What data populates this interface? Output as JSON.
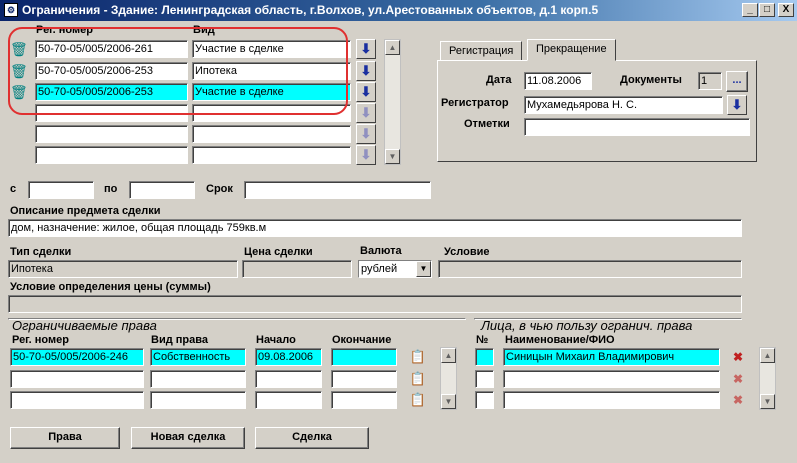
{
  "window": {
    "title": "Ограничения - Здание: Ленинградская область, г.Волхов, ул.Арестованных объектов, д.1 корп.5",
    "minimize": "_",
    "maximize": "□",
    "close": "X"
  },
  "deals": {
    "col_reg": "Рег. номер",
    "col_kind": "Вид",
    "rows": [
      {
        "reg": "50-70-05/005/2006-261",
        "kind": "Участие в сделке"
      },
      {
        "reg": "50-70-05/005/2006-253",
        "kind": "Ипотека"
      },
      {
        "reg": "50-70-05/005/2006-253",
        "kind": "Участие в сделке"
      },
      {
        "reg": "",
        "kind": ""
      },
      {
        "reg": "",
        "kind": ""
      },
      {
        "reg": "",
        "kind": ""
      }
    ]
  },
  "tabs": {
    "registration": "Регистрация",
    "termination": "Прекращение"
  },
  "termination": {
    "date_label": "Дата",
    "date_value": "11.08.2006",
    "docs_label": "Документы",
    "docs_value": "1",
    "docs_button": "...",
    "registrar_label": "Регистратор",
    "registrar_value": "Мухамедьярова Н. С.",
    "notes_label": "Отметки",
    "notes_value": ""
  },
  "period": {
    "from_label": "с",
    "from_value": "",
    "to_label": "по",
    "to_value": "",
    "term_label": "Срок",
    "term_value": ""
  },
  "subject": {
    "label": "Описание предмета сделки",
    "value": "дом, назначение: жилое, общая площадь 759кв.м"
  },
  "deal_info": {
    "type_label": "Тип сделки",
    "type_value": "Ипотека",
    "price_label": "Цена сделки",
    "price_value": "",
    "currency_label": "Валюта",
    "currency_value": "рублей",
    "condition_label": "Условие",
    "condition_value": "",
    "price_cond_label": "Условие определения цены (суммы)",
    "price_cond_value": ""
  },
  "rights": {
    "heading": "Ограничиваемые права",
    "col_reg": "Рег. номер",
    "col_kind": "Вид права",
    "col_start": "Начало",
    "col_end": "Окончание",
    "rows": [
      {
        "reg": "50-70-05/005/2006-246",
        "kind": "Собственность",
        "start": "09.08.2006",
        "end": ""
      },
      {
        "reg": "",
        "kind": "",
        "start": "",
        "end": ""
      },
      {
        "reg": "",
        "kind": "",
        "start": "",
        "end": ""
      }
    ]
  },
  "persons": {
    "heading": "Лица, в чью пользу огранич. права",
    "col_num": "№",
    "col_name": "Наименование/ФИО",
    "rows": [
      {
        "num": "",
        "name": "Синицын  Михаил Владимирович"
      },
      {
        "num": "",
        "name": ""
      },
      {
        "num": "",
        "name": ""
      }
    ]
  },
  "buttons": {
    "rights": "Права",
    "new_deal": "Новая сделка",
    "deal": "Сделка"
  },
  "colors": {
    "selected": "#00ffff",
    "title_bar": "#0a246a",
    "annotation": "#e03030"
  }
}
